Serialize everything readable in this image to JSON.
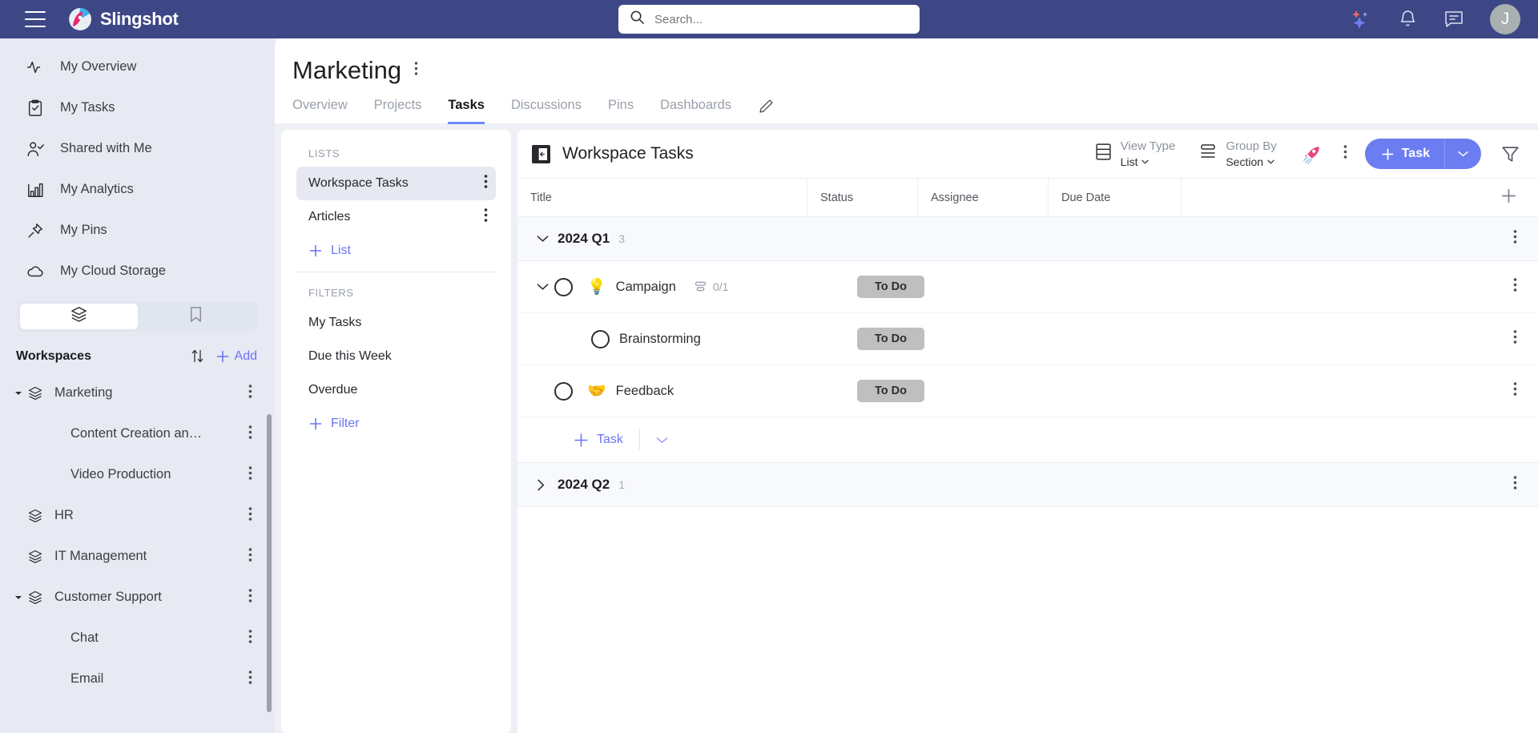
{
  "app": {
    "brand": "Slingshot",
    "accent": "#6b7df0",
    "header_bg": "#3d4785"
  },
  "search": {
    "placeholder": "Search...",
    "value": ""
  },
  "topbar": {
    "icons": [
      "ai-sparkle-icon",
      "notifications-bell-icon",
      "chat-icon"
    ],
    "avatar_initial": "J"
  },
  "sidebar": {
    "nav": [
      {
        "label": "My Overview",
        "icon": "activity-icon"
      },
      {
        "label": "My Tasks",
        "icon": "clipboard-check-icon"
      },
      {
        "label": "Shared with Me",
        "icon": "user-check-icon"
      },
      {
        "label": "My Analytics",
        "icon": "bar-chart-icon"
      },
      {
        "label": "My Pins",
        "icon": "pin-icon"
      },
      {
        "label": "My Cloud Storage",
        "icon": "cloud-icon"
      }
    ],
    "segmented": {
      "left_icon": "layers-icon",
      "right_icon": "bookmark-icon",
      "selected": "left"
    },
    "workspaces_title": "Workspaces",
    "sort_icon": "sort-arrows-icon",
    "add_label": "Add",
    "workspaces": [
      {
        "label": "Marketing",
        "level": 0,
        "expanded": true
      },
      {
        "label": "Content Creation an…",
        "level": 1
      },
      {
        "label": "Video Production",
        "level": 1
      },
      {
        "label": "HR",
        "level": 0
      },
      {
        "label": "IT Management",
        "level": 0
      },
      {
        "label": "Customer Support",
        "level": 0,
        "expanded": true
      },
      {
        "label": "Chat",
        "level": 1
      },
      {
        "label": "Email",
        "level": 1
      }
    ]
  },
  "page": {
    "title": "Marketing",
    "tabs": [
      {
        "label": "Overview",
        "active": false
      },
      {
        "label": "Projects",
        "active": false
      },
      {
        "label": "Tasks",
        "active": true
      },
      {
        "label": "Discussions",
        "active": false
      },
      {
        "label": "Pins",
        "active": false
      },
      {
        "label": "Dashboards",
        "active": false
      }
    ]
  },
  "lists_panel": {
    "lists_caption": "LISTS",
    "lists": [
      {
        "label": "Workspace Tasks",
        "selected": true
      },
      {
        "label": "Articles",
        "selected": false
      }
    ],
    "add_list_label": "List",
    "filters_caption": "FILTERS",
    "filters": [
      {
        "label": "My Tasks"
      },
      {
        "label": "Due this Week"
      },
      {
        "label": "Overdue"
      }
    ],
    "add_filter_label": "Filter"
  },
  "task_panel": {
    "name": "Workspace Tasks",
    "collapse_icon": "collapse-panel-icon",
    "view_type": {
      "label": "View Type",
      "value": "List",
      "icon": "list-view-icon"
    },
    "group_by": {
      "label": "Group By",
      "value": "Section",
      "icon": "group-by-icon"
    },
    "rocket_icon": "rocket-icon",
    "more_icon": "more-vertical-icon",
    "add_task_label": "Task",
    "filter_icon": "filter-funnel-icon",
    "columns": [
      "Title",
      "Status",
      "Assignee",
      "Due Date"
    ],
    "add_column_icon": "plus-icon",
    "groups": [
      {
        "name": "2024 Q1",
        "count": "3",
        "expanded": true,
        "rows": [
          {
            "title": "Campaign",
            "emoji": "💡",
            "status": "To Do",
            "assignee": "",
            "due_date": "",
            "subtask_count": "0/1",
            "expandable": true,
            "indent": 0
          },
          {
            "title": "Brainstorming",
            "emoji": "",
            "status": "To Do",
            "assignee": "",
            "due_date": "",
            "subtask_count": "",
            "expandable": false,
            "indent": 1
          },
          {
            "title": "Feedback",
            "emoji": "🤝",
            "status": "To Do",
            "assignee": "",
            "due_date": "",
            "subtask_count": "",
            "expandable": false,
            "indent": 0
          }
        ],
        "add_row_label": "Task"
      },
      {
        "name": "2024 Q2",
        "count": "1",
        "expanded": false,
        "rows": []
      }
    ],
    "status_pill_color": "#bfbfbf"
  }
}
